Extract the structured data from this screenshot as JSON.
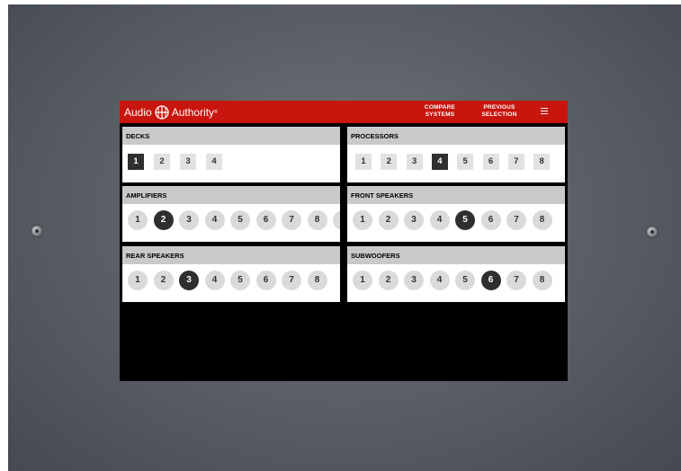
{
  "brand": {
    "left": "Audio",
    "right": "Authority",
    "mark": "®"
  },
  "nav": {
    "compare": [
      "COMPARE",
      "SYSTEMS"
    ],
    "previous": [
      "PREVIOUS",
      "SELECTION"
    ],
    "menu_icon": "hamburger-menu-icon"
  },
  "colors": {
    "header": "#c8150d",
    "selected": "#2f2f2f",
    "item": "#dadada",
    "title_bar": "#c9c9c9"
  },
  "sections": {
    "decks": {
      "title": "DECKS",
      "options": [
        "1",
        "2",
        "3",
        "4"
      ],
      "selected": "1"
    },
    "processors": {
      "title": "PROCESSORS",
      "options": [
        "1",
        "2",
        "3",
        "4",
        "5",
        "6",
        "7",
        "8"
      ],
      "selected": "4"
    },
    "amplifiers": {
      "title": "AMPLIFIERS",
      "options": [
        "1",
        "2",
        "3",
        "4",
        "5",
        "6",
        "7",
        "8"
      ],
      "selected": "2"
    },
    "front_speakers": {
      "title": "FRONT SPEAKERS",
      "options": [
        "1",
        "2",
        "3",
        "4",
        "5",
        "6",
        "7",
        "8"
      ],
      "selected": "5"
    },
    "rear_speakers": {
      "title": "REAR SPEAKERS",
      "options": [
        "1",
        "2",
        "3",
        "4",
        "5",
        "6",
        "7",
        "8"
      ],
      "selected": "3"
    },
    "subwoofers": {
      "title": "SUBWOOFERS",
      "options": [
        "1",
        "2",
        "3",
        "4",
        "5",
        "6",
        "7",
        "8"
      ],
      "selected": "6"
    }
  }
}
